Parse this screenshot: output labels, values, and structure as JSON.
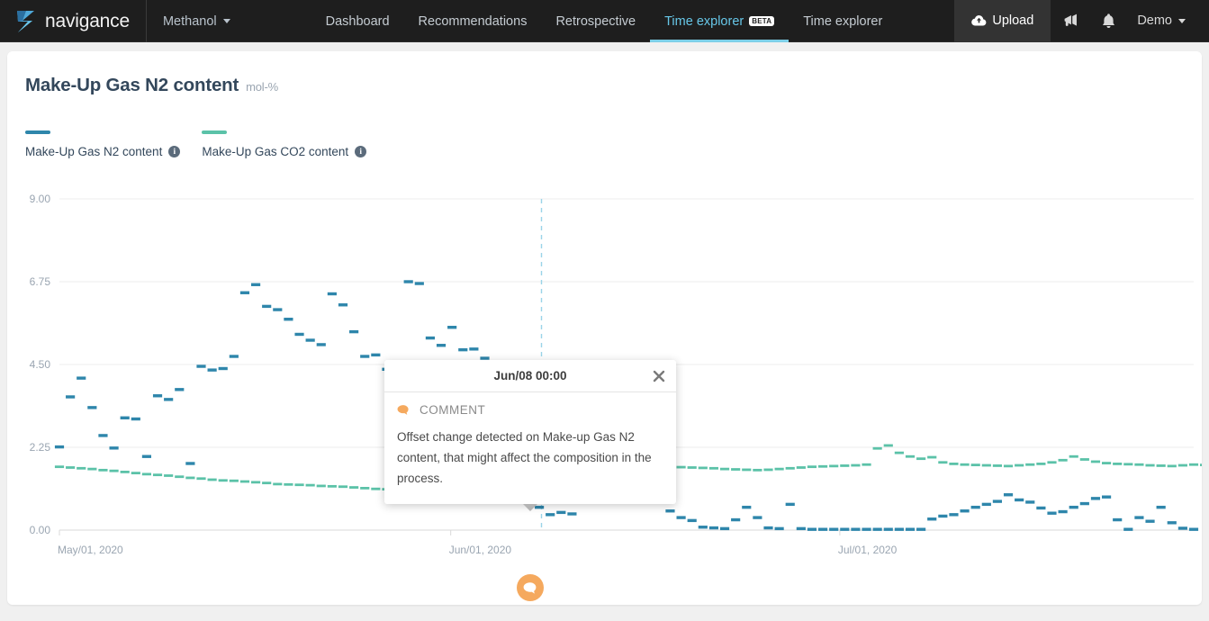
{
  "nav": {
    "brand": "navigance",
    "brand_logo_icon": "navigance-logo-icon",
    "plant": "Methanol",
    "plant_caret_icon": "chevron-down-icon",
    "links": [
      {
        "label": "Dashboard",
        "active": false,
        "badge": null
      },
      {
        "label": "Recommendations",
        "active": false,
        "badge": null
      },
      {
        "label": "Retrospective",
        "active": false,
        "badge": null
      },
      {
        "label": "Time explorer",
        "active": true,
        "badge": "BETA"
      },
      {
        "label": "Time explorer",
        "active": false,
        "badge": null
      }
    ],
    "upload_label": "Upload",
    "upload_icon": "cloud-upload-icon",
    "announcement_icon": "megaphone-icon",
    "notifications_icon": "bell-icon",
    "user_label": "Demo",
    "user_caret_icon": "chevron-down-icon"
  },
  "card": {
    "title": "Make-Up Gas N2 content",
    "unit": "mol-%"
  },
  "legend": [
    {
      "label": "Make-Up Gas N2 content",
      "color": "#2e86ab",
      "info_icon": "info-icon",
      "info_glyph": "i"
    },
    {
      "label": "Make-Up Gas CO2 content",
      "color": "#5bc2a8",
      "info_icon": "info-icon",
      "info_glyph": "i"
    }
  ],
  "popup": {
    "title": "Jun/08 00:00",
    "close_icon": "close-icon",
    "kind_icon": "comment-bubble-icon",
    "kind_label": "COMMENT",
    "text": "Offset change detected on Make-up Gas N2 content, that might affect the composition in the process."
  },
  "marker": {
    "icon": "comment-bubble-marker-icon",
    "color": "#f5a95e"
  },
  "colors": {
    "nav_bg": "#1e1e1e",
    "accent": "#7ecfe8",
    "series_n2": "#2e86ab",
    "series_co2": "#5bc2a8",
    "comment_orange": "#f5a95e",
    "grid": "#ececec",
    "axis_text": "#9aa5b1"
  },
  "chart_data": {
    "type": "line",
    "title": "Make-Up Gas N2 content",
    "ylabel": "mol-%",
    "xlabel": "",
    "ylim": [
      0,
      9
    ],
    "yticks": [
      "0.00",
      "2.25",
      "4.50",
      "6.75",
      "9.00"
    ],
    "ytick_values": [
      0,
      2.25,
      4.5,
      6.75,
      9
    ],
    "xticks": [
      "May/01, 2020",
      "Jun/01, 2020",
      "Jul/01, 2020"
    ],
    "xtick_positions": [
      0,
      0.345,
      0.688
    ],
    "grid": true,
    "legend_position": "top-left",
    "annotation": {
      "x_label": "Jun/08 00:00",
      "x_position": 0.425,
      "type": "comment",
      "text": "Offset change detected on Make-up Gas N2 content, that might affect the composition in the process."
    },
    "series": [
      {
        "name": "Make-Up Gas N2 content",
        "color": "#2e86ab",
        "style": "stepped-dashes",
        "values": [
          2.26,
          3.62,
          4.13,
          3.33,
          2.57,
          2.23,
          3.05,
          3.02,
          2.0,
          3.65,
          3.55,
          3.82,
          1.81,
          4.45,
          4.35,
          4.39,
          4.72,
          6.45,
          6.67,
          6.08,
          5.99,
          5.73,
          5.32,
          5.16,
          5.04,
          6.42,
          6.12,
          5.39,
          4.72,
          4.76,
          4.37,
          4.29,
          6.75,
          6.7,
          5.22,
          5.02,
          5.51,
          4.9,
          4.92,
          4.67,
          4.42,
          2.48,
          2.25,
          1.05,
          0.62,
          0.42,
          0.48,
          0.44,
          0.94,
          1.25,
          1.16,
          1.45,
          1.56,
          1.28,
          1.36,
          1.22,
          0.52,
          0.34,
          0.26,
          0.08,
          0.06,
          0.04,
          0.28,
          0.62,
          0.34,
          0.06,
          0.04,
          0.7,
          0.04,
          0.02,
          0.02,
          0.02,
          0.02,
          0.02,
          0.02,
          0.02,
          0.02,
          0.02,
          0.02,
          0.02,
          0.3,
          0.38,
          0.42,
          0.52,
          0.62,
          0.7,
          0.78,
          0.96,
          0.82,
          0.76,
          0.6,
          0.46,
          0.5,
          0.62,
          0.72,
          0.86,
          0.9,
          0.28,
          0.02,
          0.34,
          0.24,
          0.62,
          0.2,
          0.05,
          0.02
        ]
      },
      {
        "name": "Make-Up Gas CO2 content",
        "color": "#5bc2a8",
        "style": "stepped-line",
        "values": [
          1.72,
          1.7,
          1.68,
          1.66,
          1.63,
          1.61,
          1.58,
          1.55,
          1.52,
          1.5,
          1.48,
          1.45,
          1.42,
          1.4,
          1.37,
          1.35,
          1.34,
          1.32,
          1.3,
          1.28,
          1.25,
          1.24,
          1.23,
          1.22,
          1.2,
          1.19,
          1.18,
          1.16,
          1.14,
          1.12,
          1.11,
          1.13,
          1.15,
          1.18,
          1.22,
          1.28,
          1.36,
          1.45,
          1.48,
          1.52,
          1.56,
          1.6,
          1.64,
          1.68,
          1.7,
          1.69,
          1.68,
          1.67,
          1.66,
          1.65,
          1.66,
          1.67,
          1.68,
          1.69,
          1.7,
          1.71,
          1.72,
          1.71,
          1.7,
          1.69,
          1.68,
          1.66,
          1.65,
          1.64,
          1.63,
          1.64,
          1.66,
          1.68,
          1.7,
          1.72,
          1.73,
          1.74,
          1.75,
          1.76,
          1.78,
          2.22,
          2.3,
          2.1,
          2.0,
          1.94,
          1.98,
          1.84,
          1.8,
          1.78,
          1.77,
          1.76,
          1.75,
          1.74,
          1.76,
          1.78,
          1.8,
          1.84,
          1.9,
          2.0,
          1.92,
          1.86,
          1.82,
          1.8,
          1.79,
          1.78,
          1.76,
          1.75,
          1.74,
          1.76,
          1.78,
          1.77,
          1.76,
          1.78
        ]
      }
    ]
  }
}
